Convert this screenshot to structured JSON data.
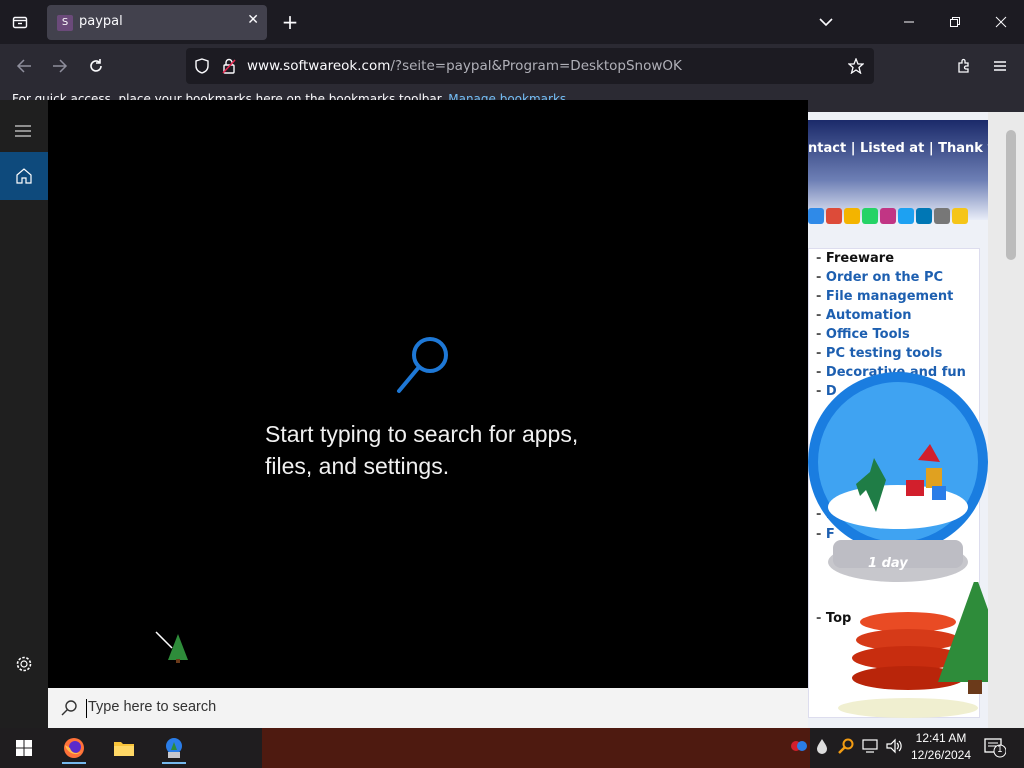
{
  "browser": {
    "tab_title": "paypal",
    "url_domain": "www.softwareok.com",
    "url_path": "/?seite=paypal&Program=DesktopSnowOK",
    "bookmarks_text": "For quick access, place your bookmarks here on the bookmarks toolbar.",
    "bookmarks_link": "Manage bookmarks"
  },
  "webpage": {
    "nav": "ntact | Listed at | Thank you",
    "menu_items": [
      "Freeware",
      "Order on the PC",
      "File management",
      "Automation",
      "Office Tools",
      "PC testing tools",
      "Decorative and fun",
      "D",
      "F",
      "F"
    ],
    "top_link": "Top",
    "globe_label": "1 day"
  },
  "start_search": {
    "message_line1": "Start typing to search for apps,",
    "message_line2": "files, and settings.",
    "search_placeholder": "Type here to search"
  },
  "taskbar": {
    "time": "12:41 AM",
    "date": "12/26/2024",
    "notification_count": "1"
  },
  "colors": {
    "accent": "#0e4a7c",
    "link": "#1d5fb0",
    "search_icon": "#1e78d6"
  }
}
